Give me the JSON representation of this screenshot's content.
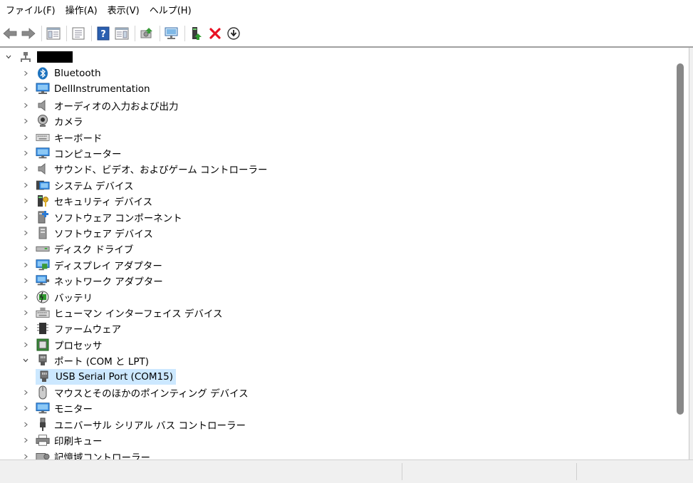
{
  "menu": [
    {
      "label": "ファイル(F)"
    },
    {
      "label": "操作(A)"
    },
    {
      "label": "表示(V)"
    },
    {
      "label": "ヘルプ(H)"
    }
  ],
  "toolbar": {
    "icons": [
      "back-arrow-icon",
      "forward-arrow-icon",
      "show-hide-tree-icon",
      "properties-icon",
      "help-icon",
      "action-pane-icon",
      "update-driver-icon",
      "scan-hardware-icon",
      "enable-device-icon",
      "uninstall-device-icon",
      "download-icon"
    ]
  },
  "tree": {
    "root_label": "",
    "items": [
      {
        "label": "Bluetooth",
        "icon": "bluetooth-icon",
        "expanded": false
      },
      {
        "label": "DellInstrumentation",
        "icon": "monitor-network-icon",
        "expanded": false
      },
      {
        "label": "オーディオの入力および出力",
        "icon": "speaker-icon",
        "expanded": false
      },
      {
        "label": "カメラ",
        "icon": "camera-icon",
        "expanded": false
      },
      {
        "label": "キーボード",
        "icon": "keyboard-icon",
        "expanded": false
      },
      {
        "label": "コンピューター",
        "icon": "computer-icon",
        "expanded": false
      },
      {
        "label": "サウンド、ビデオ、およびゲーム コントローラー",
        "icon": "speaker-icon",
        "expanded": false
      },
      {
        "label": "システム デバイス",
        "icon": "system-device-icon",
        "expanded": false
      },
      {
        "label": "セキュリティ デバイス",
        "icon": "security-key-icon",
        "expanded": false
      },
      {
        "label": "ソフトウェア コンポーネント",
        "icon": "software-component-icon",
        "expanded": false
      },
      {
        "label": "ソフトウェア デバイス",
        "icon": "software-device-icon",
        "expanded": false
      },
      {
        "label": "ディスク ドライブ",
        "icon": "disk-drive-icon",
        "expanded": false
      },
      {
        "label": "ディスプレイ アダプター",
        "icon": "display-adapter-icon",
        "expanded": false
      },
      {
        "label": "ネットワーク アダプター",
        "icon": "network-adapter-icon",
        "expanded": false
      },
      {
        "label": "バッテリ",
        "icon": "battery-icon",
        "expanded": false
      },
      {
        "label": "ヒューマン インターフェイス デバイス",
        "icon": "hid-icon",
        "expanded": false
      },
      {
        "label": "ファームウェア",
        "icon": "firmware-chip-icon",
        "expanded": false
      },
      {
        "label": "プロセッサ",
        "icon": "processor-icon",
        "expanded": false
      },
      {
        "label": "ポート (COM と LPT)",
        "icon": "port-icon",
        "expanded": true
      },
      {
        "label": "USB Serial Port (COM15)",
        "icon": "port-icon",
        "child": true,
        "selected": true
      },
      {
        "label": "マウスとそのほかのポインティング デバイス",
        "icon": "mouse-icon",
        "expanded": false
      },
      {
        "label": "モニター",
        "icon": "monitor-icon",
        "expanded": false
      },
      {
        "label": "ユニバーサル シリアル バス コントローラー",
        "icon": "usb-icon",
        "expanded": false
      },
      {
        "label": "印刷キュー",
        "icon": "printer-icon",
        "expanded": false
      },
      {
        "label": "記憶域コントローラー",
        "icon": "storage-controller-icon",
        "expanded": false
      }
    ]
  },
  "colors": {
    "selection": "#cce8ff",
    "accent_blue": "#1e73be",
    "delete_red": "#e81123"
  }
}
